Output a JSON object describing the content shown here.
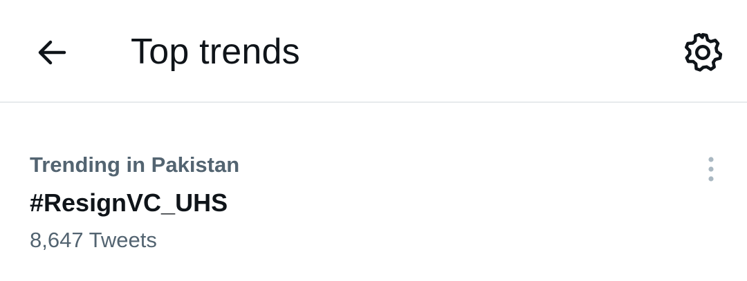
{
  "header": {
    "back_icon": "arrow-left-icon",
    "title": "Top trends",
    "settings_icon": "gear-icon"
  },
  "trends": [
    {
      "context": "Trending in Pakistan",
      "name": "#ResignVC_UHS",
      "count": "8,647 Tweets",
      "more_icon": "more-vertical-icon"
    }
  ],
  "colors": {
    "primary_text": "#0f1419",
    "secondary_text": "#536471",
    "divider": "#e7eaec",
    "icon_muted": "#aab8c2",
    "background": "#ffffff"
  }
}
